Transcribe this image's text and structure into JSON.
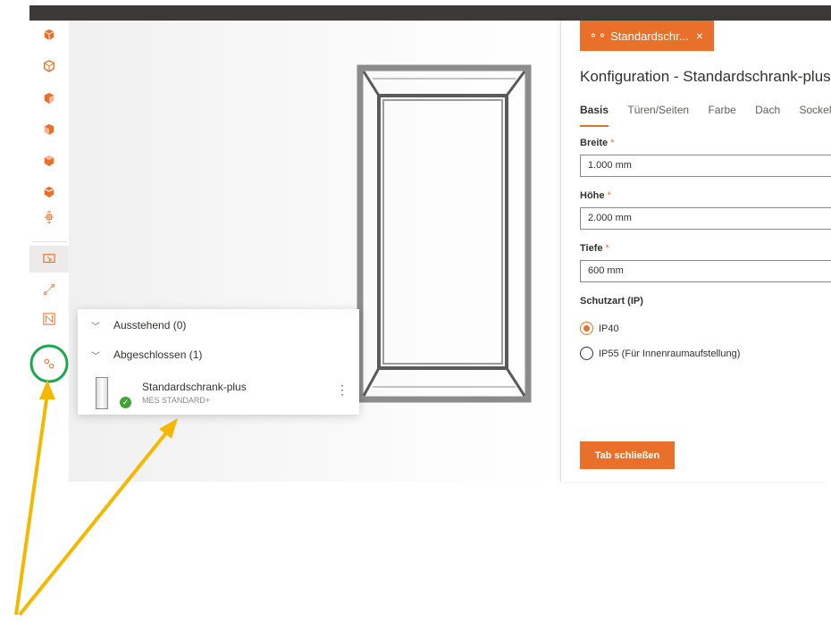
{
  "sidebar": {
    "icons": [
      "cube-icon",
      "cube-open-icon",
      "cube-left-icon",
      "cube-right-icon",
      "cube-top-icon",
      "cube-front-icon",
      "rotate-icon",
      "screen-select-icon",
      "measure-icon",
      "blueprint-icon",
      "configurator-icon"
    ]
  },
  "tab": {
    "label": "Standardschr...",
    "close": "×"
  },
  "panel": {
    "title": "Konfiguration - Standardschrank-plus",
    "subtabs": [
      "Basis",
      "Türen/Seiten",
      "Farbe",
      "Dach",
      "Sockel"
    ],
    "fields": {
      "width": {
        "label": "Breite",
        "required": "*",
        "value": "1.000 mm"
      },
      "height": {
        "label": "Höhe",
        "required": "*",
        "value": "2.000 mm"
      },
      "depth": {
        "label": "Tiefe",
        "required": "*",
        "value": "600 mm"
      }
    },
    "protection": {
      "label": "Schutzart (IP)",
      "options": [
        "IP40",
        "IP55 (Für Innenraumaufstellung)"
      ],
      "selected": "IP40"
    },
    "close_button": "Tab schließen"
  },
  "popover": {
    "pending": "Ausstehend (0)",
    "completed": "Abgeschlossen (1)",
    "item": {
      "name": "Standardschrank-plus",
      "subtitle": "MES STANDARD+",
      "menu": "⋮",
      "status": "✓"
    }
  },
  "colors": {
    "accent": "#e8702a",
    "highlight_circle": "#1aa84a",
    "annotation_arrow": "#f5b800",
    "success": "#3fa535"
  }
}
